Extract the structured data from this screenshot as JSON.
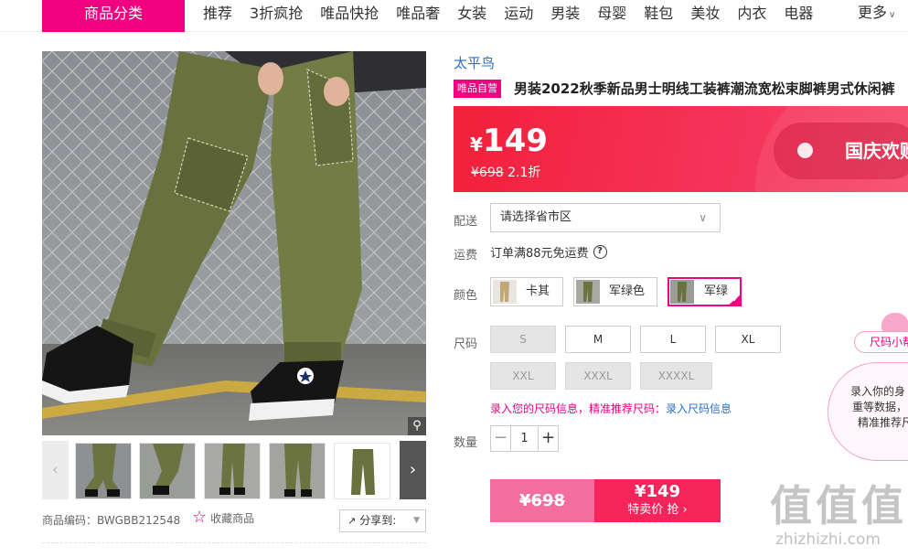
{
  "nav": {
    "category_button": "商品分类",
    "links": [
      "推荐",
      "3折疯抢",
      "唯品快抢",
      "唯品奢",
      "女装",
      "运动",
      "男装",
      "母婴",
      "鞋包",
      "美妆",
      "内衣",
      "电器"
    ],
    "more": "更多"
  },
  "gallery": {
    "thumbnail_count": 5,
    "product_code_label": "商品编码：",
    "product_code": "BWGBB212548",
    "favorite_label": "收藏商品",
    "share_label": "分享到:"
  },
  "product": {
    "brand": "太平鸟",
    "self_badge": "唯品自营",
    "title": "男装2022秋季新品男士明线工装裤潮流宽松束脚裤男式休闲裤"
  },
  "price": {
    "currency": "¥",
    "current": "149",
    "original": "¥698",
    "discount": "2.1折",
    "promo_text": "国庆欢购"
  },
  "delivery": {
    "label": "配送",
    "placeholder": "请选择省市区"
  },
  "shipping": {
    "label": "运费",
    "text": "订单满88元免运费"
  },
  "colors": {
    "label": "颜色",
    "options": [
      "卡其",
      "军绿色",
      "军绿"
    ],
    "selected": "军绿"
  },
  "sizes": {
    "label": "尺码",
    "options": [
      "S",
      "M",
      "L",
      "XL",
      "XXL",
      "XXXL",
      "XXXXL"
    ],
    "available": [
      "M",
      "L",
      "XL"
    ],
    "hint": "录入您的尺码信息，精准推荐尺码：",
    "hint_link": "录入尺码信息"
  },
  "quantity": {
    "label": "数量",
    "value": "1"
  },
  "buy": {
    "original": "¥698",
    "price": "¥149",
    "action": "特卖价 抢"
  },
  "size_helper": {
    "pill": "尺码小帮",
    "lines": [
      "录入你的身",
      "重等数据，",
      "精准推荐尺"
    ]
  },
  "watermark": {
    "text": "值值值",
    "url": "zhizhizhi.com"
  },
  "colors_theme": {
    "accent": "#f10180",
    "price_red": "#f5245b",
    "link_blue": "#2a6fc9"
  }
}
